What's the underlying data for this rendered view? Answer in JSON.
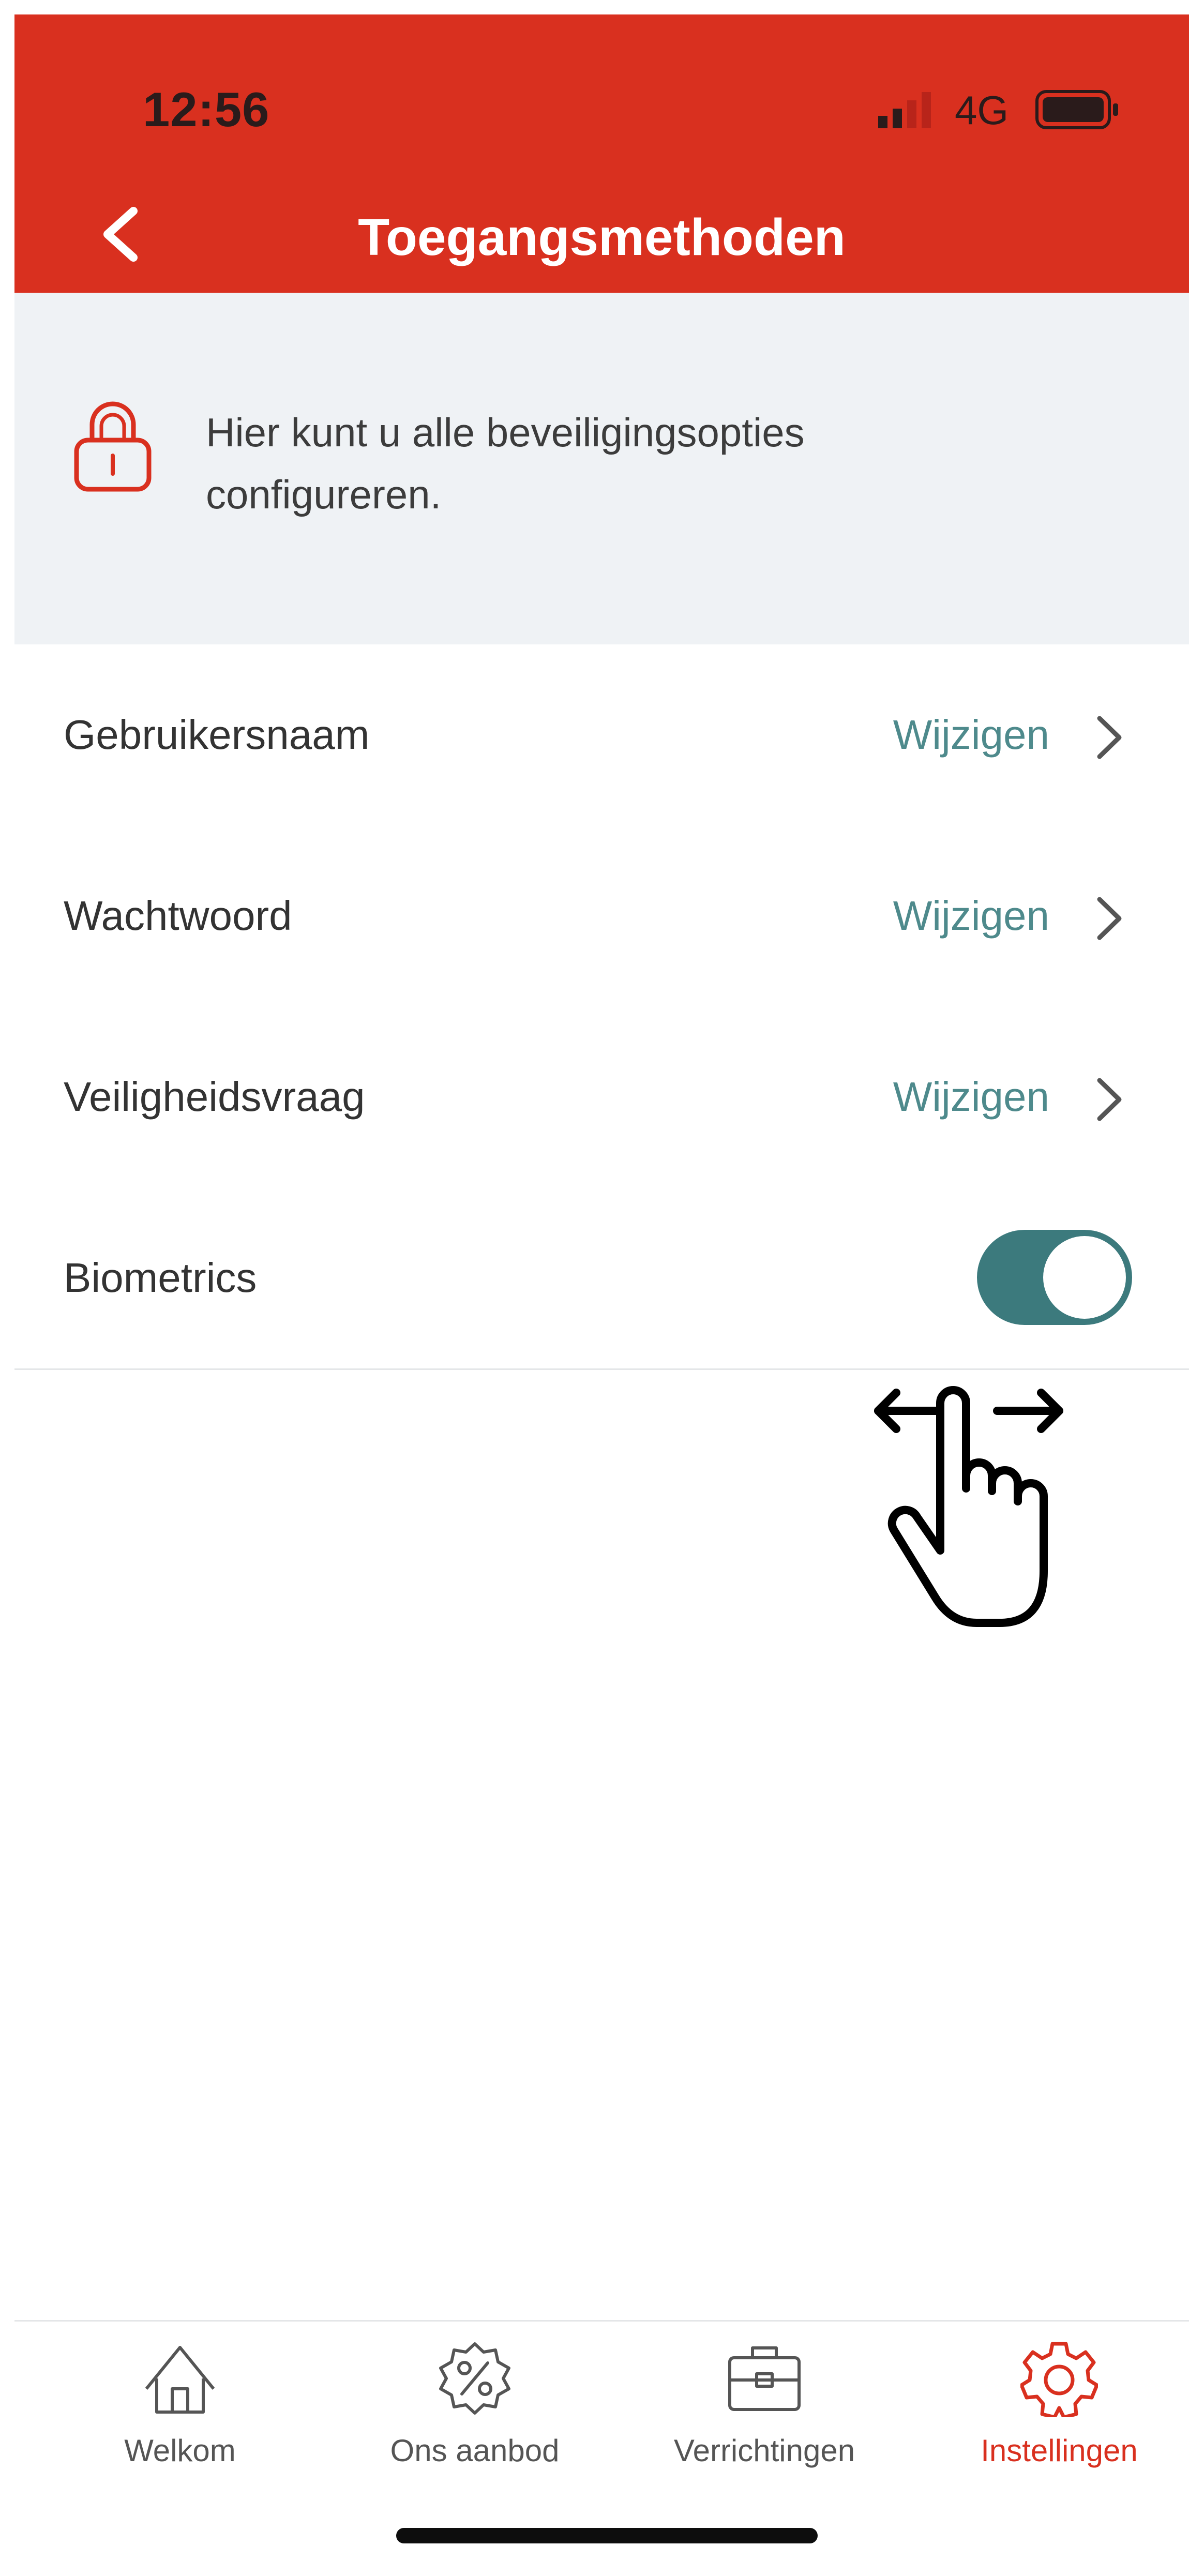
{
  "status_bar": {
    "time": "12:56",
    "network": "4G"
  },
  "header": {
    "title": "Toegangsmethoden",
    "accent_color": "#d9301f"
  },
  "banner": {
    "text": "Hier kunt u alle beveiligingsopties configureren.",
    "icon": "lock-icon"
  },
  "settings": [
    {
      "label": "Gebruikersnaam",
      "action": "Wijzigen"
    },
    {
      "label": "Wachtwoord",
      "action": "Wijzigen"
    },
    {
      "label": "Veiligheidsvraag",
      "action": "Wijzigen"
    }
  ],
  "biometrics": {
    "label": "Biometrics",
    "enabled": true,
    "toggle_color": "#3c7a7d"
  },
  "tabs": [
    {
      "label": "Welkom",
      "icon": "home-icon"
    },
    {
      "label": "Ons aanbod",
      "icon": "discount-icon"
    },
    {
      "label": "Verrichtingen",
      "icon": "briefcase-icon"
    },
    {
      "label": "Instellingen",
      "icon": "gear-icon",
      "active": true
    }
  ]
}
